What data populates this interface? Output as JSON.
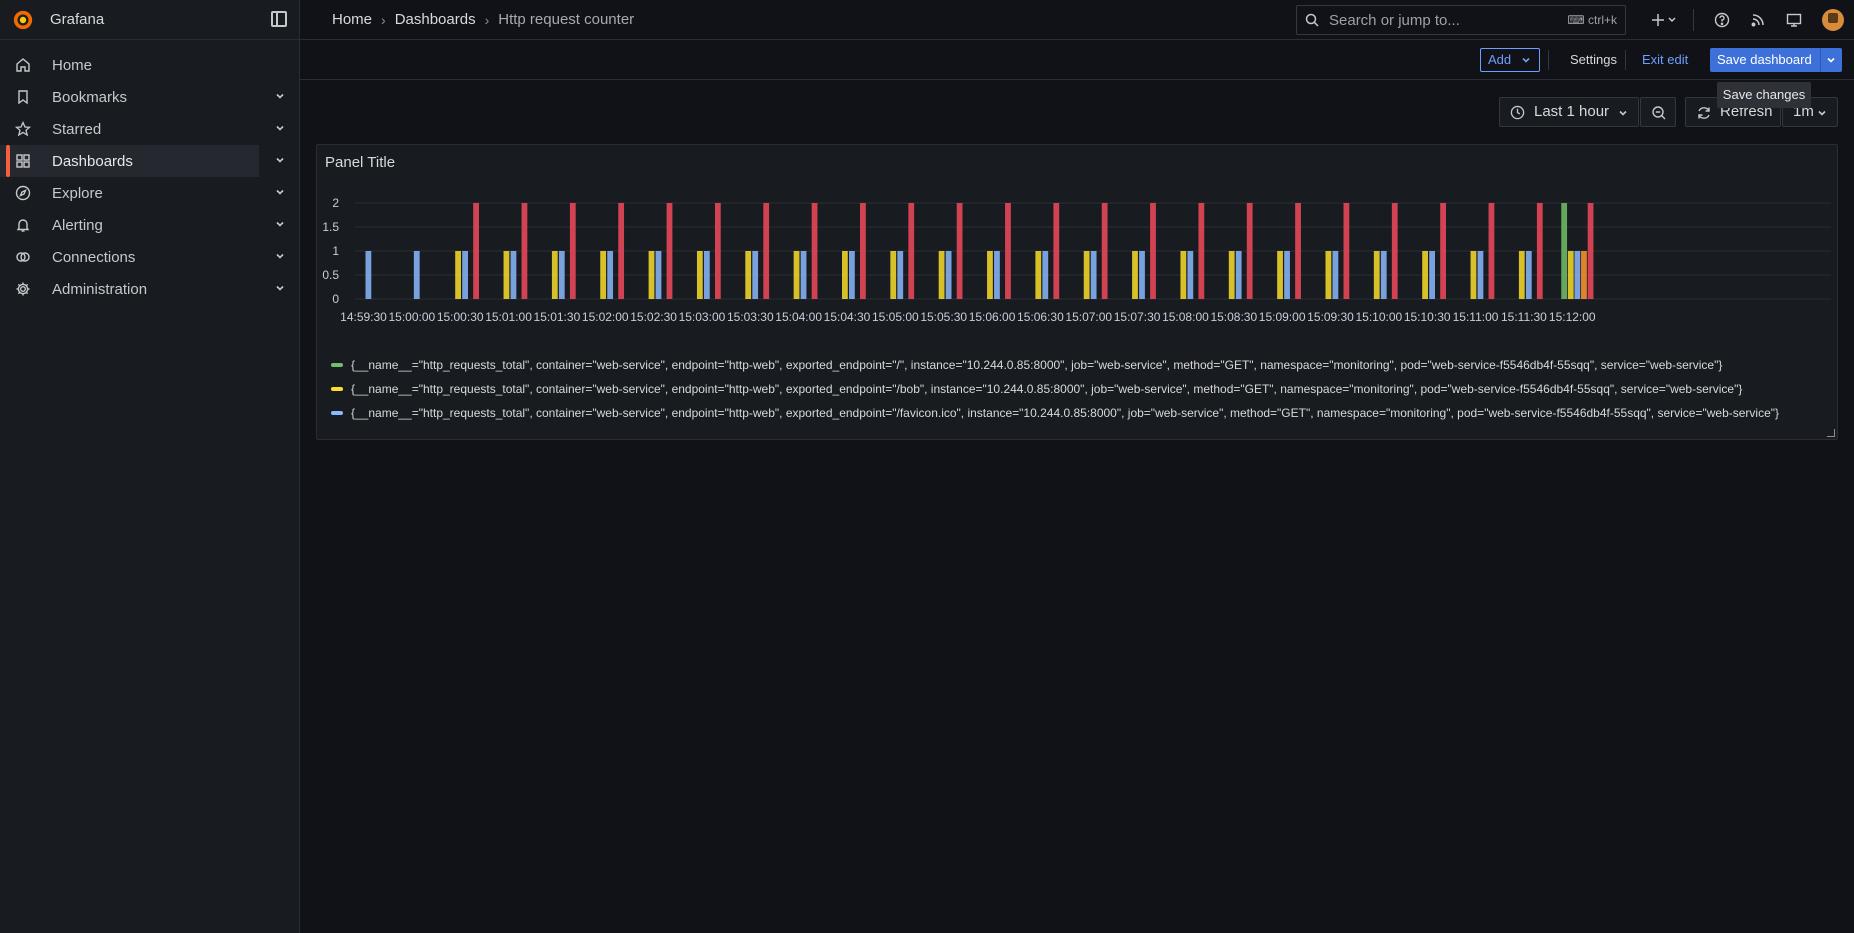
{
  "brand": {
    "name": "Grafana"
  },
  "sidebar": {
    "items": [
      {
        "label": "Home",
        "icon": "home-icon",
        "expandable": false
      },
      {
        "label": "Bookmarks",
        "icon": "bookmark-icon",
        "expandable": true
      },
      {
        "label": "Starred",
        "icon": "star-icon",
        "expandable": true
      },
      {
        "label": "Dashboards",
        "icon": "dashboards-grid-icon",
        "expandable": true,
        "active": true
      },
      {
        "label": "Explore",
        "icon": "compass-icon",
        "expandable": true
      },
      {
        "label": "Alerting",
        "icon": "bell-icon",
        "expandable": true
      },
      {
        "label": "Connections",
        "icon": "connections-icon",
        "expandable": true
      },
      {
        "label": "Administration",
        "icon": "gear-icon",
        "expandable": true
      }
    ]
  },
  "breadcrumb": {
    "items": [
      "Home",
      "Dashboards"
    ],
    "current": "Http request counter"
  },
  "search": {
    "placeholder": "Search or jump to...",
    "shortcut": "ctrl+k"
  },
  "toolbar": {
    "add_label": "Add",
    "settings_label": "Settings",
    "exit_edit_label": "Exit edit",
    "save_label": "Save dashboard",
    "tooltip": "Save changes"
  },
  "time_controls": {
    "range_label": "Last 1 hour",
    "refresh_label": "Refresh",
    "interval_label": "1m"
  },
  "colors": {
    "accent": "#3d71d9",
    "link": "#6e9fff",
    "series_green": "#73bf69",
    "series_yellow": "#fade2a",
    "series_blue": "#8ab8ff",
    "series_red": "#f2495c",
    "series_orange": "#ff9830"
  },
  "panel": {
    "title": "Panel Title",
    "legend": [
      {
        "color": "#73bf69",
        "text": "{__name__=\"http_requests_total\", container=\"web-service\", endpoint=\"http-web\", exported_endpoint=\"/\", instance=\"10.244.0.85:8000\", job=\"web-service\", method=\"GET\", namespace=\"monitoring\", pod=\"web-service-f5546db4f-55sqq\", service=\"web-service\"}"
      },
      {
        "color": "#fade2a",
        "text": "{__name__=\"http_requests_total\", container=\"web-service\", endpoint=\"http-web\", exported_endpoint=\"/bob\", instance=\"10.244.0.85:8000\", job=\"web-service\", method=\"GET\", namespace=\"monitoring\", pod=\"web-service-f5546db4f-55sqq\", service=\"web-service\"}"
      },
      {
        "color": "#8ab8ff",
        "text": "{__name__=\"http_requests_total\", container=\"web-service\", endpoint=\"http-web\", exported_endpoint=\"/favicon.ico\", instance=\"10.244.0.85:8000\", job=\"web-service\", method=\"GET\", namespace=\"monitoring\", pod=\"web-service-f5546db4f-55sqq\", service=\"web-service\"}"
      }
    ]
  },
  "chart_data": {
    "type": "bar",
    "title": "Panel Title",
    "xlabel": "",
    "ylabel": "",
    "ylim": [
      0,
      2
    ],
    "yticks": [
      "2",
      "1.5",
      "1",
      "0.5",
      "0"
    ],
    "grid": true,
    "legend_placement": "bottom",
    "xticks": [
      "14:59:30",
      "15:00:00",
      "15:00:30",
      "15:01:00",
      "15:01:30",
      "15:02:00",
      "15:02:30",
      "15:03:00",
      "15:03:30",
      "15:04:00",
      "15:04:30",
      "15:05:00",
      "15:05:30",
      "15:06:00",
      "15:06:30",
      "15:07:00",
      "15:07:30",
      "15:08:00",
      "15:08:30",
      "15:09:00",
      "15:09:30",
      "15:10:00",
      "15:10:30",
      "15:11:00",
      "15:11:30",
      "15:12:00"
    ],
    "categories": [
      "14:59:30",
      "15:00:00",
      "15:00:30",
      "15:01:00",
      "15:01:30",
      "15:02:00",
      "15:02:30",
      "15:03:00",
      "15:03:30",
      "15:04:00",
      "15:04:30",
      "15:05:00",
      "15:05:30",
      "15:06:00",
      "15:06:30",
      "15:07:00",
      "15:07:30",
      "15:08:00",
      "15:08:30",
      "15:09:00",
      "15:09:30",
      "15:10:00",
      "15:10:30",
      "15:11:00",
      "15:11:30",
      "15:12:00"
    ],
    "series": [
      {
        "color": "#73bf69",
        "values": [
          0,
          0,
          0,
          0,
          0,
          0,
          0,
          0,
          0,
          0,
          0,
          0,
          0,
          0,
          0,
          0,
          0,
          0,
          0,
          0,
          0,
          0,
          0,
          0,
          0,
          2
        ]
      },
      {
        "color": "#fade2a",
        "values": [
          0,
          0,
          1,
          1,
          1,
          1,
          1,
          1,
          1,
          1,
          1,
          1,
          1,
          1,
          1,
          1,
          1,
          1,
          1,
          1,
          1,
          1,
          1,
          1,
          1,
          1
        ]
      },
      {
        "color": "#8ab8ff",
        "values": [
          1,
          1,
          1,
          1,
          1,
          1,
          1,
          1,
          1,
          1,
          1,
          1,
          1,
          1,
          1,
          1,
          1,
          1,
          1,
          1,
          1,
          1,
          1,
          1,
          1,
          1
        ]
      },
      {
        "color": "#ff9830",
        "values": [
          0,
          0,
          0,
          0,
          0,
          0,
          0,
          0,
          0,
          0,
          0,
          0,
          0,
          0,
          0,
          0,
          0,
          0,
          0,
          0,
          0,
          0,
          0,
          0,
          0,
          1
        ]
      },
      {
        "color": "#f2495c",
        "values": [
          0,
          0,
          2,
          2,
          2,
          2,
          2,
          2,
          2,
          2,
          2,
          2,
          2,
          2,
          2,
          2,
          2,
          2,
          2,
          2,
          2,
          2,
          2,
          2,
          2,
          2
        ]
      }
    ]
  }
}
